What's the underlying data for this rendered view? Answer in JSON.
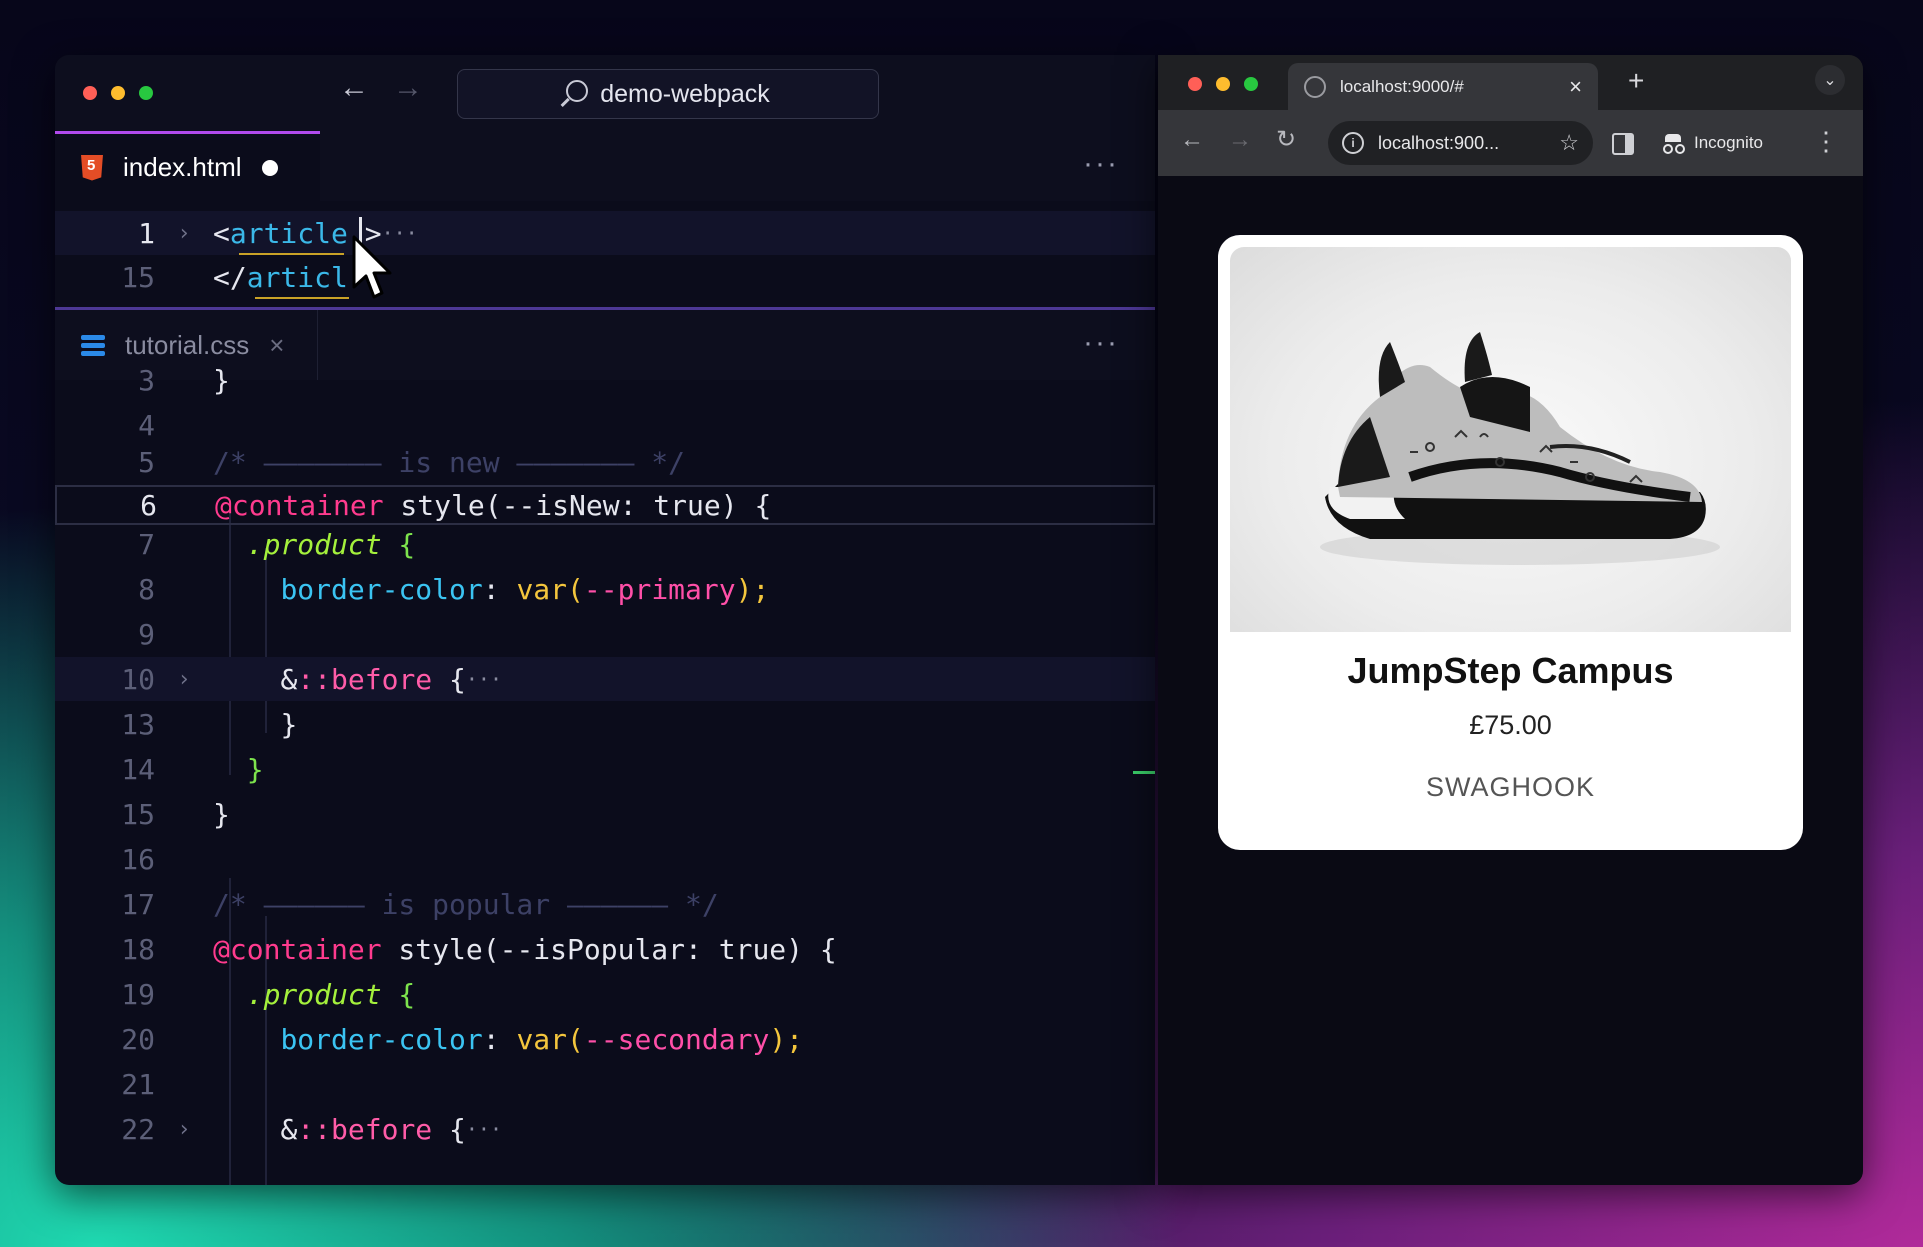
{
  "editor": {
    "search_label": "demo-webpack",
    "html_tab": {
      "filename": "index.html"
    },
    "css_tab": {
      "filename": "tutorial.css"
    },
    "more_label": "···",
    "html_lines": [
      {
        "num": "1",
        "open": "<",
        "tag": "article",
        "close": ">",
        "ellipsis": "···"
      },
      {
        "num": "15",
        "open": "</",
        "tag": "articl"
      }
    ],
    "css_lines": [
      {
        "num": "3",
        "brace": "}"
      },
      {
        "num": "4"
      },
      {
        "num": "5",
        "comment": "/* ——————— is new ——————— */"
      },
      {
        "num": "6",
        "at": "@container",
        "rest": " style(--isNew: true) {"
      },
      {
        "num": "7",
        "sel": ".product",
        "brace": " {"
      },
      {
        "num": "8",
        "prop": "border-color",
        "colon": ": ",
        "fn": "var(",
        "var": "--primary",
        "end": ");"
      },
      {
        "num": "9"
      },
      {
        "num": "10",
        "amp": "&",
        "pseudo": "::before",
        "brace": " {",
        "ellipsis": "···"
      },
      {
        "num": "13",
        "brace": "}"
      },
      {
        "num": "14",
        "brace": "}"
      },
      {
        "num": "15",
        "brace": "}"
      },
      {
        "num": "16"
      },
      {
        "num": "17",
        "comment": "/* —————— is popular —————— */"
      },
      {
        "num": "18",
        "at": "@container",
        "rest": " style(--isPopular: true) {"
      },
      {
        "num": "19",
        "sel": ".product",
        "brace": " {"
      },
      {
        "num": "20",
        "prop": "border-color",
        "colon": ": ",
        "fn": "var(",
        "var": "--secondary",
        "end": ");"
      },
      {
        "num": "21"
      },
      {
        "num": "22",
        "amp": "&",
        "pseudo": "::before",
        "brace": " {",
        "ellipsis": "···"
      }
    ]
  },
  "browser": {
    "tab_title": "localhost:9000/#",
    "tab_close": "×",
    "new_tab": "+",
    "url": "localhost:900...",
    "incognito_label": "Incognito"
  },
  "product": {
    "name": "JumpStep Campus",
    "price": "£75.00",
    "brand": "SWAGHOOK"
  },
  "colors": {
    "accent": "#b14aed",
    "at_rule": "#ff3b8e",
    "selector": "#a4f03c",
    "property": "#3bc4f2",
    "variable": "#ff4fa8"
  }
}
